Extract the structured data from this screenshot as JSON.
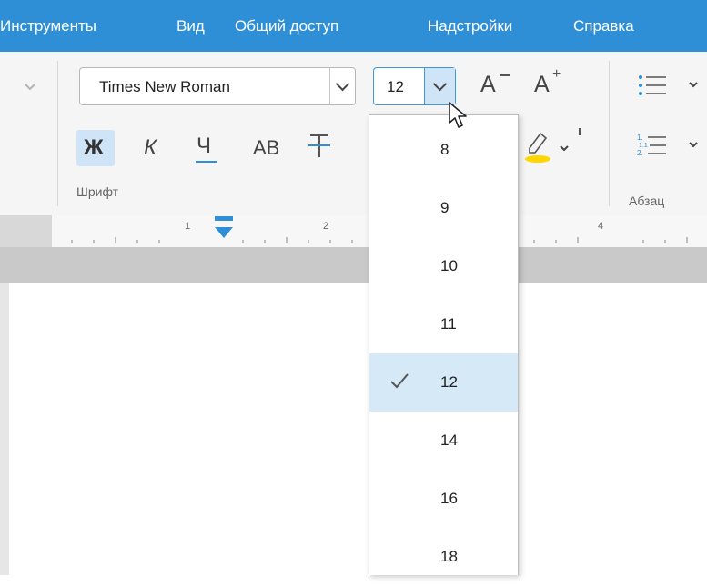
{
  "menu": {
    "items": [
      "Инструменты",
      "Вид",
      "Общий доступ",
      "Надстройки",
      "Справка"
    ]
  },
  "ribbon": {
    "font_name": "Times New Roman",
    "font_size": "12",
    "font_group_label": "Шрифт",
    "paragraph_group_label": "Абзац",
    "bold_label": "Ж",
    "italic_label": "К",
    "underline_label": "Ч",
    "caps_label": "АВ",
    "increase_size_label": "A",
    "decrease_size_label": "A"
  },
  "size_dropdown": {
    "options": [
      "8",
      "9",
      "10",
      "11",
      "12",
      "14",
      "16",
      "18"
    ],
    "selected": "12"
  },
  "ruler": {
    "numbers": [
      "1",
      "2",
      "4"
    ]
  },
  "colors": {
    "menubar": "#2f8fd6",
    "accent": "#1e88e5",
    "selected_option": "#d5e9f7",
    "highlight": "#ffd600"
  },
  "icons": [
    "chevron-down-icon",
    "list-bullets-icon",
    "list-numbered-icon",
    "highlighter-icon",
    "check-icon",
    "mouse-cursor-icon",
    "strikethrough-icon"
  ]
}
